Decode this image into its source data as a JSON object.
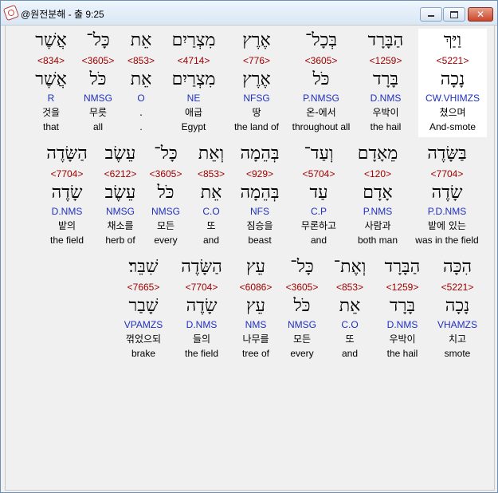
{
  "window": {
    "title": "@원전분해 - 출 9:25",
    "close_label": "✕"
  },
  "rows": [
    [
      {
        "heb": "וַיַּךְ",
        "strong": "<5221>",
        "lemma": "נָכָה",
        "morph": "CW.VHIMZS",
        "kor": "쳤으며",
        "eng": "And-smote",
        "hl": true
      },
      {
        "heb": "הַבָּרָד",
        "strong": "<1259>",
        "lemma": "בָּרָד",
        "morph": "D.NMS",
        "kor": "우박이",
        "eng": "the hail"
      },
      {
        "heb": "בְּכָל־",
        "strong": "<3605>",
        "lemma": "כֹּל",
        "morph": "P.NMSG",
        "kor": "온-에서",
        "eng": "throughout all"
      },
      {
        "heb": "אֶרֶץ",
        "strong": "<776>",
        "lemma": "אֶרֶץ",
        "morph": "NFSG",
        "kor": "땅",
        "eng": "the land of"
      },
      {
        "heb": "מִצְרַיִם",
        "strong": "<4714>",
        "lemma": "מִצְרַיִם",
        "morph": "NE",
        "kor": "애굽",
        "eng": "Egypt"
      },
      {
        "heb": "אֵת",
        "strong": "<853>",
        "lemma": "אֵת",
        "morph": "O",
        "kor": ".",
        "eng": "."
      },
      {
        "heb": "כָּל־",
        "strong": "<3605>",
        "lemma": "כֹּל",
        "morph": "NMSG",
        "kor": "무릇",
        "eng": "all"
      },
      {
        "heb": "אֲשֶׁר",
        "strong": "<834>",
        "lemma": "אֲשֶׁר",
        "morph": "R",
        "kor": "것을",
        "eng": "that"
      }
    ],
    [
      {
        "heb": "בַּשָּׂדֶה",
        "strong": "<7704>",
        "lemma": "שָׂדֶה",
        "morph": "P.D.NMS",
        "kor": "밭에 있는",
        "eng": "was in the field"
      },
      {
        "heb": "מֵאָדָם",
        "strong": "<120>",
        "lemma": "אָדָם",
        "morph": "P.NMS",
        "kor": "사람과",
        "eng": "both man"
      },
      {
        "heb": "וְעַד־",
        "strong": "<5704>",
        "lemma": "עַד",
        "morph": "C.P",
        "kor": "무론하고",
        "eng": "and"
      },
      {
        "heb": "בְּהֵמָה",
        "strong": "<929>",
        "lemma": "בְּהֵמָה",
        "morph": "NFS",
        "kor": "짐승을",
        "eng": "beast"
      },
      {
        "heb": "וְאֵת",
        "strong": "<853>",
        "lemma": "אֵת",
        "morph": "C.O",
        "kor": "또",
        "eng": "and"
      },
      {
        "heb": "כָּל־",
        "strong": "<3605>",
        "lemma": "כֹּל",
        "morph": "NMSG",
        "kor": "모든",
        "eng": "every"
      },
      {
        "heb": "עֵשֶׂב",
        "strong": "<6212>",
        "lemma": "עֵשֶׂב",
        "morph": "NMSG",
        "kor": "채소를",
        "eng": "herb of"
      },
      {
        "heb": "הַשָּׂדֶה",
        "strong": "<7704>",
        "lemma": "שָׂדֶה",
        "morph": "D.NMS",
        "kor": "밭의",
        "eng": "the field"
      }
    ],
    [
      {
        "heb": "הִכָּה",
        "strong": "<5221>",
        "lemma": "נָכָה",
        "morph": "VHAMZS",
        "kor": "치고",
        "eng": "smote"
      },
      {
        "heb": "הַבָּרָד",
        "strong": "<1259>",
        "lemma": "בָּרָד",
        "morph": "D.NMS",
        "kor": "우박이",
        "eng": "the hail"
      },
      {
        "heb": "וְאֶת־",
        "strong": "<853>",
        "lemma": "אֵת",
        "morph": "C.O",
        "kor": "또",
        "eng": "and"
      },
      {
        "heb": "כָּל־",
        "strong": "<3605>",
        "lemma": "כֹּל",
        "morph": "NMSG",
        "kor": "모든",
        "eng": "every"
      },
      {
        "heb": "עֵץ",
        "strong": "<6086>",
        "lemma": "עֵץ",
        "morph": "NMS",
        "kor": "나무를",
        "eng": "tree of"
      },
      {
        "heb": "הַשָּׂדֶה",
        "strong": "<7704>",
        "lemma": "שָׂדֶה",
        "morph": "D.NMS",
        "kor": "들의",
        "eng": "the field"
      },
      {
        "heb": "שִׁבֵּר׃",
        "strong": "<7665>",
        "lemma": "שָׁבַר",
        "morph": "VPAMZS",
        "kor": "꺾었으되",
        "eng": "brake"
      }
    ]
  ]
}
